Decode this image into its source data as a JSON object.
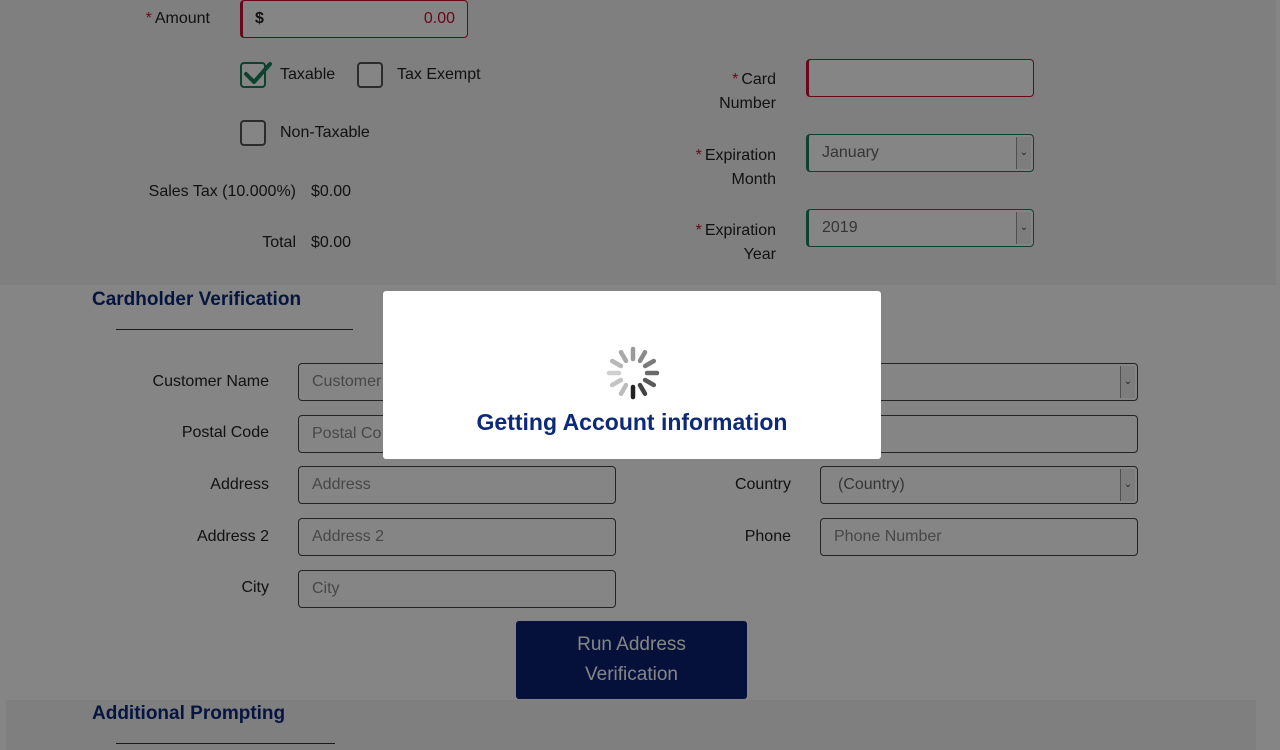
{
  "payment": {
    "amount_label": "Amount",
    "currency_symbol": "$",
    "amount_value": "0.00",
    "taxable_label": "Taxable",
    "taxable_checked": true,
    "tax_exempt_label": "Tax Exempt",
    "non_taxable_label": "Non-Taxable",
    "sales_tax_label": "Sales Tax (10.000%)",
    "sales_tax_value": "$0.00",
    "total_label": "Total",
    "total_value": "$0.00"
  },
  "card": {
    "card_number_label_1": "Card",
    "card_number_label_2": "Number",
    "exp_month_label_1": "Expiration",
    "exp_month_label_2": "Month",
    "exp_month_value": "January",
    "exp_year_label_1": "Expiration",
    "exp_year_label_2": "Year",
    "exp_year_value": "2019"
  },
  "verification": {
    "title": "Cardholder Verification",
    "customer_name_label": "Customer Name",
    "customer_name_placeholder": "Customer",
    "postal_code_label": "Postal Code",
    "postal_code_placeholder": "Postal Co",
    "address_label": "Address",
    "address_placeholder": "Address",
    "address2_label": "Address 2",
    "address2_placeholder": "Address 2",
    "city_label": "City",
    "city_placeholder": "City",
    "state_select_partial": ")",
    "country_label": "Country",
    "country_value": "(Country)",
    "phone_label": "Phone",
    "phone_placeholder": "Phone Number",
    "run_button_line1": "Run Address",
    "run_button_line2": "Verification"
  },
  "additional": {
    "title": "Additional Prompting"
  },
  "modal": {
    "message": "Getting Account information"
  },
  "colors": {
    "required": "#c8102e",
    "valid": "#1a7f5a",
    "brand": "#0b2170"
  }
}
